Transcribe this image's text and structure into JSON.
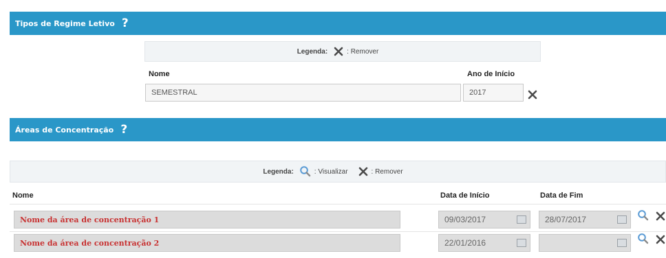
{
  "section1": {
    "title": "Tipos de Regime Letivo",
    "help": "?",
    "legend_label": "Legenda:",
    "legend_remove": ": Remover",
    "col_name": "Nome",
    "col_year": "Ano de Início",
    "rows": [
      {
        "name": "SEMESTRAL",
        "year": "2017"
      }
    ]
  },
  "section2": {
    "title": "Áreas de Concentração",
    "help": "?",
    "legend_label": "Legenda:",
    "legend_view": ": Visualizar",
    "legend_remove": ": Remover",
    "col_name": "Nome",
    "col_start": "Data de Início",
    "col_end": "Data de Fim",
    "rows": [
      {
        "name": "Nome da área de concentração 1",
        "start": "09/03/2017",
        "end": "28/07/2017"
      },
      {
        "name": "Nome da área de concentração 2",
        "start": "22/01/2016",
        "end": ""
      }
    ]
  },
  "colors": {
    "header": "#2a97c8",
    "name_text": "#c83232"
  },
  "icons": [
    "help-icon",
    "remove-icon",
    "view-icon",
    "calendar-icon"
  ]
}
